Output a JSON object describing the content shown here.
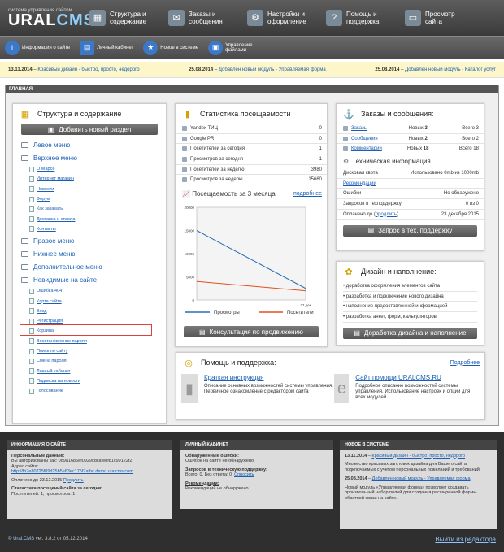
{
  "logo": {
    "tagline": "система управления сайтом",
    "brand_a": "URAL",
    "brand_b": "CMS"
  },
  "nav": [
    {
      "l1": "Структура и",
      "l2": "содержание",
      "icon": "sitemap-icon"
    },
    {
      "l1": "Заказы и",
      "l2": "сообщения",
      "icon": "mail-icon"
    },
    {
      "l1": "Настройки и",
      "l2": "оформление",
      "icon": "settings-icon"
    },
    {
      "l1": "Помощь и",
      "l2": "поддержка",
      "icon": "help-icon"
    },
    {
      "l1": "Просмотр",
      "l2": "сайта",
      "icon": "monitor-icon"
    }
  ],
  "bar2": [
    {
      "label": "Информация о сайте"
    },
    {
      "label": "Личный кабинет"
    },
    {
      "label": "Новое в системе"
    },
    {
      "label": "Управление файлами"
    }
  ],
  "news": [
    {
      "date": "13.11.2014",
      "text": "Красивый дизайн - быстро, просто, недорого"
    },
    {
      "date": "25.08.2014",
      "text": "Добавлен новый модуль - Управляемая форма"
    },
    {
      "date": "25.08.2014",
      "text": "Добавлен новый модуль - Каталог услуг"
    }
  ],
  "main_title": "ГЛАВНАЯ",
  "structure": {
    "title": "Структура и содержание",
    "add_btn": "Добавить новый раздел",
    "sections": [
      "Левое меню",
      "Верхнее меню"
    ],
    "top_menu_items": [
      "О Марсе",
      "Интернет магазин",
      "Новости",
      "Форум",
      "Как заказать",
      "Доставка и оплата",
      "Контакты"
    ],
    "more_sections": [
      "Правое меню",
      "Нижнее меню",
      "Дополнительное меню",
      "Невидимые на сайте"
    ],
    "hidden_items": [
      "Ошибка 404",
      "Карта сайта",
      "Вход",
      "Регистрация",
      "Корзина",
      "Восстановление пароля",
      "Поиск по сайту",
      "Смена пароля",
      "Личный кабинет",
      "Подписка на новости",
      "Голосование"
    ]
  },
  "stats": {
    "title": "Статистика посещаемости",
    "rows": [
      {
        "label": "Yandex ТИЦ",
        "value": "0"
      },
      {
        "label": "Google PR",
        "value": "0"
      },
      {
        "label": "Посетителей за сегодня",
        "value": "1"
      },
      {
        "label": "Просмотров за сегодня",
        "value": "1"
      },
      {
        "label": "Посетителей за неделю",
        "value": "3980"
      },
      {
        "label": "Просмотров за неделю",
        "value": "15660"
      }
    ],
    "chart_title": "Посещаемость за 3 месяца",
    "more": "подробнее",
    "consult_btn": "Консультация по продвижению"
  },
  "chart_data": {
    "type": "line",
    "x": [
      "",
      "22 дек"
    ],
    "ylim": [
      0,
      20000
    ],
    "yticks": [
      "20000",
      "15000",
      "10000",
      "5000",
      "0"
    ],
    "series": [
      {
        "name": "Просмотры",
        "values": [
          15000,
          2500
        ],
        "color": "#2a6db5"
      },
      {
        "name": "Посетители",
        "values": [
          4000,
          2000
        ],
        "color": "#e0501e"
      }
    ]
  },
  "orders": {
    "title": "Заказы и сообщения:",
    "rows": [
      {
        "label": "Заказы",
        "new": "Новых",
        "nnum": "3",
        "total": "Всего 3"
      },
      {
        "label": "Сообщения",
        "new": "Новых",
        "nnum": "2",
        "total": "Всего 2"
      },
      {
        "label": "Комментарии",
        "new": "Новых",
        "nnum": "18",
        "total": "Всего 18"
      }
    ],
    "tech_title": "Техническая информация",
    "disk_label": "Дисковая квота",
    "disk_value": "Использовано 0mb из 1000mb",
    "recs": "Рекомендации",
    "errors_label": "Ошибки",
    "errors_value": "Не обнаружено",
    "req_label": "Запросов в техподдержку",
    "req_value": "0 из 0",
    "paid_label": "Оплачено до",
    "paid_link": "продлить",
    "paid_value": "23 декабря 2015",
    "btn": "Запрос в тех. поддержку"
  },
  "design": {
    "title": "Дизайн и наполнение:",
    "items": [
      "доработка оформления элементов сайта",
      "разработка и подключение нового дизайна",
      "наполнение предоставленной информацией",
      "разработка анкет, форм, калькуляторов"
    ],
    "btn": "Доработка дизайна и наполнение"
  },
  "help": {
    "title": "Помощь и поддержка:",
    "more": "Подробнее",
    "a_link": "Краткая инструкция",
    "a_text": "Описание основных возможностей системы управления. Первичное ознакомление с редактором сайта",
    "b_link": "Сайт помощи URALCMS.RU",
    "b_text": "Подробное описание возможностей системы управления. Использование настроек и опций для всех модулей"
  },
  "finfo": {
    "title": "ИНФОРМАЦИЯ О САЙТЕ",
    "pd": "Персональные данные:",
    "auth": "Вы авторизованы как: 0d9a1686ef0929cdcafe8f81c99122f2",
    "addr_label": "Адрес сайта:",
    "addr": "http://fb7e80725f89d25b5e63ec175f7afbc.demo.uralcms.com",
    "paid": "Оплачено до 23.12.2015",
    "paid_link": "Продлить",
    "stat_title": "Статистика посещений сайта за сегодня:",
    "stat": "Посетителей: 1, просмотров: 1"
  },
  "fcab": {
    "title": "ЛИЧНЫЙ КАБИНЕТ",
    "e_title": "Обнаруженные ошибки:",
    "e_text": "Ошибок на сайте не обнаружено",
    "r_title": "Запросов в техническую поддержку:",
    "r_text": "Всего: 0. Без ответа: 0.",
    "r_link": "Спросить",
    "c_title": "Рекомендации:",
    "c_text": "Рекомендаций не обнаружено."
  },
  "fnew": {
    "title": "НОВОЕ В СИСТЕМЕ",
    "n1_date": "13.11.2014",
    "n1_link": "Красивый дизайн - быстро, просто, недорого",
    "n1_text": "Множество красивых заготовок дизайна для Вашего сайта, подключаемых с учетом персональных пожеланий и требований.",
    "n2_date": "25.08.2014",
    "n2_link": "Добавлен новый модуль - Управляемая форма",
    "n2_text": "Новый модуль «Управляемая форма» позволяет создавать произвольный набор полей для создания расширенной формы обратной связи на сайте."
  },
  "bottom": {
    "brand": "Ural.CMS",
    "version": "ver. 3.8.2 от 05.12.2014",
    "exit": "Выйти из редактора"
  }
}
